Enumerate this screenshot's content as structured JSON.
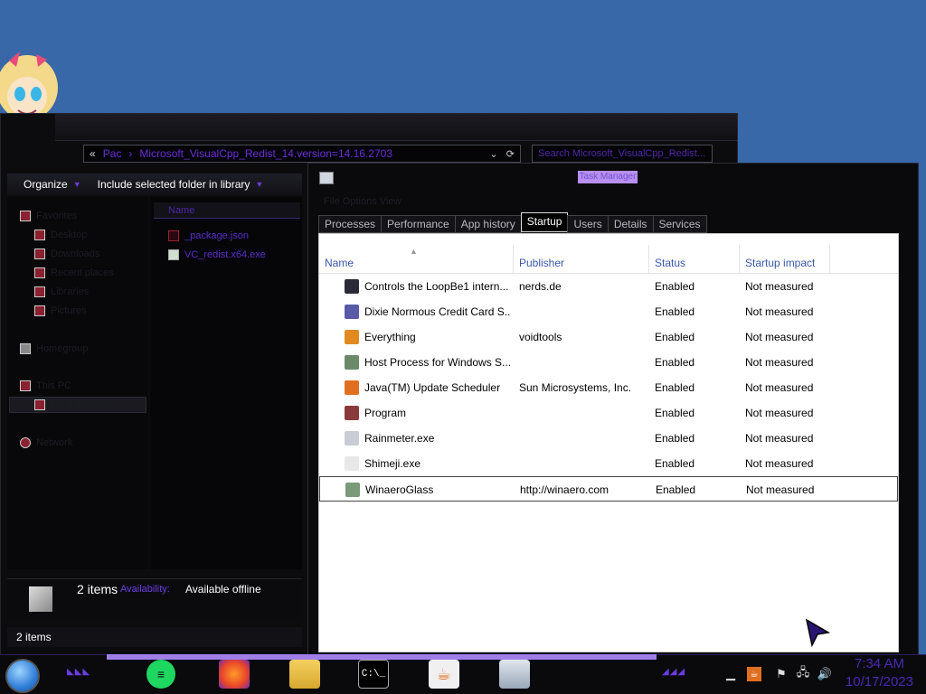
{
  "explorer": {
    "address": {
      "overflow": "«",
      "crumb1": "Pac",
      "crumb2": "Microsoft_VisualCpp_Redist_14.version=14.16.2703"
    },
    "search_placeholder": "Search Microsoft_VisualCpp_Redist...",
    "toolbar": {
      "organize": "Organize",
      "include": "Include selected folder in library"
    },
    "column_name": "Name",
    "files": [
      {
        "name": "_package.json"
      },
      {
        "name": "VC_redist.x64.exe"
      }
    ],
    "nav_items": [
      {
        "label": "Favorites"
      },
      {
        "label": "Desktop"
      },
      {
        "label": "Downloads"
      },
      {
        "label": "Recent places"
      },
      {
        "label": "Libraries"
      },
      {
        "label": "Pictures"
      },
      {
        "label": "Homegroup"
      },
      {
        "label": "This PC"
      },
      {
        "label": "Local Disk (C:)"
      },
      {
        "label": "Network"
      }
    ],
    "details": {
      "count": "2 items",
      "availability_label": "Availability:",
      "availability_value": "Available offline"
    },
    "statusbar": "2 items"
  },
  "taskmgr": {
    "title": "Task Manager",
    "menu": "File  Options  View",
    "tabs": [
      "Processes",
      "Performance",
      "App history",
      "Startup",
      "Users",
      "Details",
      "Services"
    ],
    "active_tab": "Startup",
    "columns": {
      "name": "Name",
      "publisher": "Publisher",
      "status": "Status",
      "impact": "Startup impact"
    },
    "rows": [
      {
        "name": "Controls the LoopBe1 intern...",
        "publisher": "nerds.de",
        "status": "Enabled",
        "impact": "Not measured",
        "icon": "loopbe-icon",
        "color": "#2a2a3a"
      },
      {
        "name": "Dixie Normous Credit Card S...",
        "publisher": "",
        "status": "Enabled",
        "impact": "Not measured",
        "icon": "card-icon",
        "color": "#5a5aa8"
      },
      {
        "name": "Everything",
        "publisher": "voidtools",
        "status": "Enabled",
        "impact": "Not measured",
        "icon": "magnifier-icon",
        "color": "#e08a20"
      },
      {
        "name": "Host Process for Windows S...",
        "publisher": "",
        "status": "Enabled",
        "impact": "Not measured",
        "icon": "window-icon",
        "color": "#6a8a6a"
      },
      {
        "name": "Java(TM) Update Scheduler",
        "publisher": "Sun Microsystems, Inc.",
        "status": "Enabled",
        "impact": "Not measured",
        "icon": "java-icon",
        "color": "#e07020"
      },
      {
        "name": "Program",
        "publisher": "",
        "status": "Enabled",
        "impact": "Not measured",
        "icon": "program-icon",
        "color": "#8a3a3a"
      },
      {
        "name": "Rainmeter.exe",
        "publisher": "",
        "status": "Enabled",
        "impact": "Not measured",
        "icon": "drop-icon",
        "color": "#c8ccd4"
      },
      {
        "name": "Shimeji.exe",
        "publisher": "",
        "status": "Enabled",
        "impact": "Not measured",
        "icon": "shimeji-icon",
        "color": "#e8e8e8"
      },
      {
        "name": "WinaeroGlass",
        "publisher": "http://winaero.com",
        "status": "Enabled",
        "impact": "Not measured",
        "icon": "window-icon",
        "color": "#7a9a7a"
      }
    ]
  },
  "taskbar": {
    "clock_time": "7:34 AM",
    "clock_date": "10/17/2023",
    "cmd_label": "C:\\_"
  },
  "colors": {
    "accent": "#6b3de0",
    "header_text": "#3a58a8"
  }
}
